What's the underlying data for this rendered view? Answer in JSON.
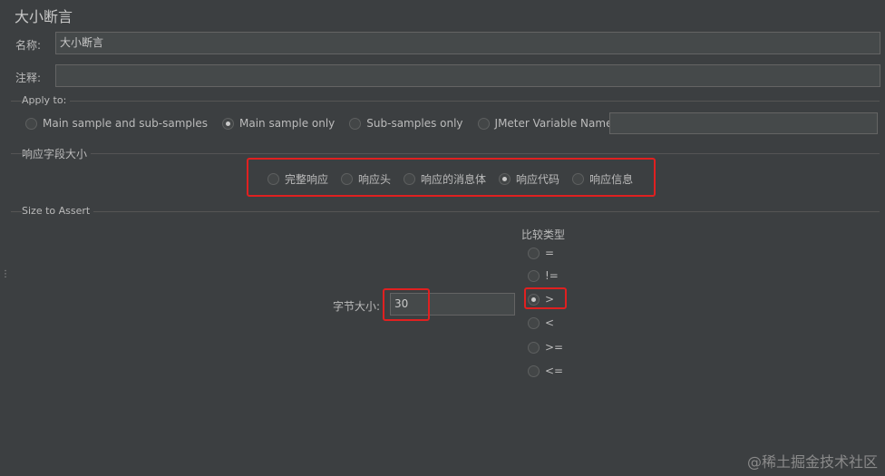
{
  "header": {
    "title": "大小断言"
  },
  "form": {
    "name_label": "名称:",
    "name_value": "大小断言",
    "comment_label": "注释:",
    "comment_value": ""
  },
  "apply_to": {
    "title": "Apply to:",
    "options": [
      {
        "label": "Main sample and sub-samples",
        "selected": false
      },
      {
        "label": "Main sample only",
        "selected": true
      },
      {
        "label": "Sub-samples only",
        "selected": false
      },
      {
        "label": "JMeter Variable Name to use",
        "selected": false
      }
    ],
    "variable_value": ""
  },
  "response_field": {
    "title": "响应字段大小",
    "options": [
      {
        "label": "完整响应",
        "selected": false
      },
      {
        "label": "响应头",
        "selected": false
      },
      {
        "label": "响应的消息体",
        "selected": false
      },
      {
        "label": "响应代码",
        "selected": true
      },
      {
        "label": "响应信息",
        "selected": false
      }
    ]
  },
  "size_assert": {
    "title": "Size to Assert",
    "bytes_label": "字节大小:",
    "bytes_value": "30",
    "compare_title": "比较类型",
    "compare_options": [
      {
        "label": "=",
        "selected": false
      },
      {
        "label": "!=",
        "selected": false
      },
      {
        "label": ">",
        "selected": true
      },
      {
        "label": "<",
        "selected": false
      },
      {
        "label": ">=",
        "selected": false
      },
      {
        "label": "<=",
        "selected": false
      }
    ]
  },
  "watermark": "@稀土掘金技术社区",
  "colors": {
    "background": "#3c3f41",
    "highlight": "#e02020"
  }
}
